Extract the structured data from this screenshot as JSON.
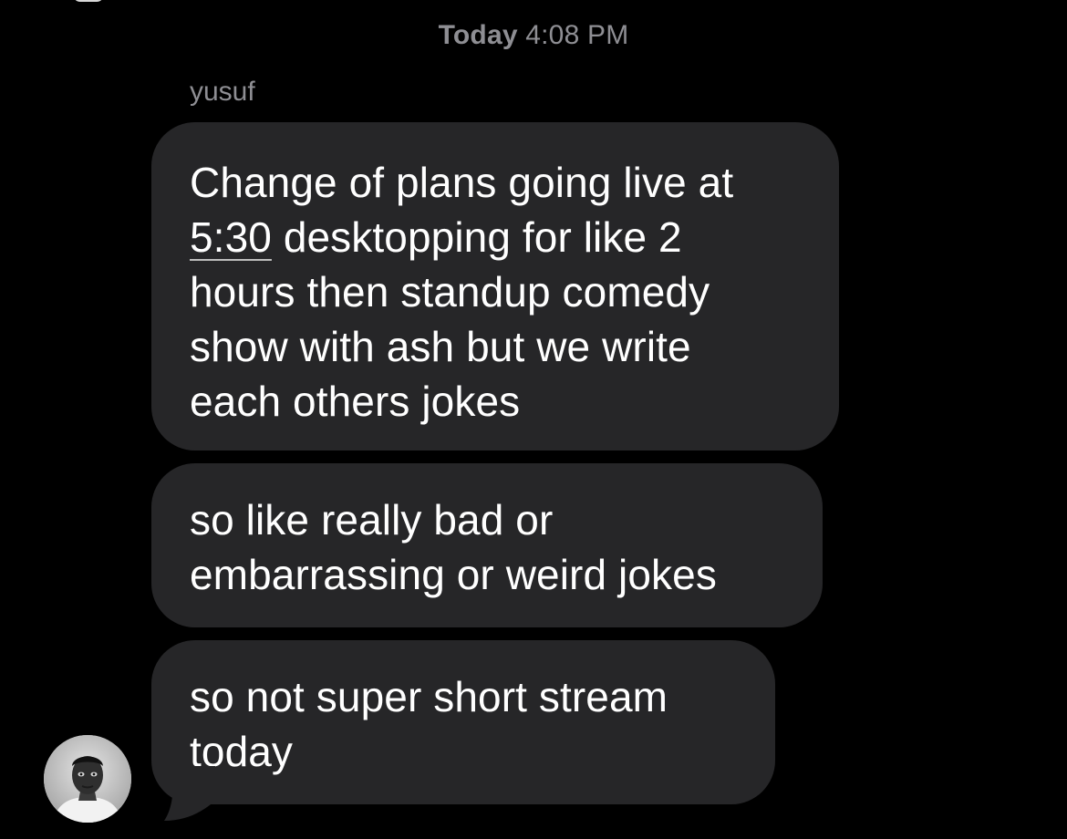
{
  "conversation": {
    "timestamp_day": "Today",
    "timestamp_time": "4:08 PM",
    "sender_name": "yusuf"
  },
  "messages": [
    {
      "line1": "Change of plans going live at",
      "line2_link": "5:30",
      "line2_rest": " desktopping for like 2",
      "line3": "hours then standup comedy",
      "line4": "show with ash but we write",
      "line5": "each others jokes"
    },
    {
      "line1": "so like really bad or",
      "line2": "embarrassing or weird jokes"
    },
    {
      "line1": "so not super short stream",
      "line2": "today"
    }
  ],
  "colors": {
    "background": "#000000",
    "bubble": "#262628",
    "meta_text": "#8e8e93",
    "message_text": "#ffffff"
  },
  "icons": {
    "avatar": "sender-avatar-photo"
  }
}
